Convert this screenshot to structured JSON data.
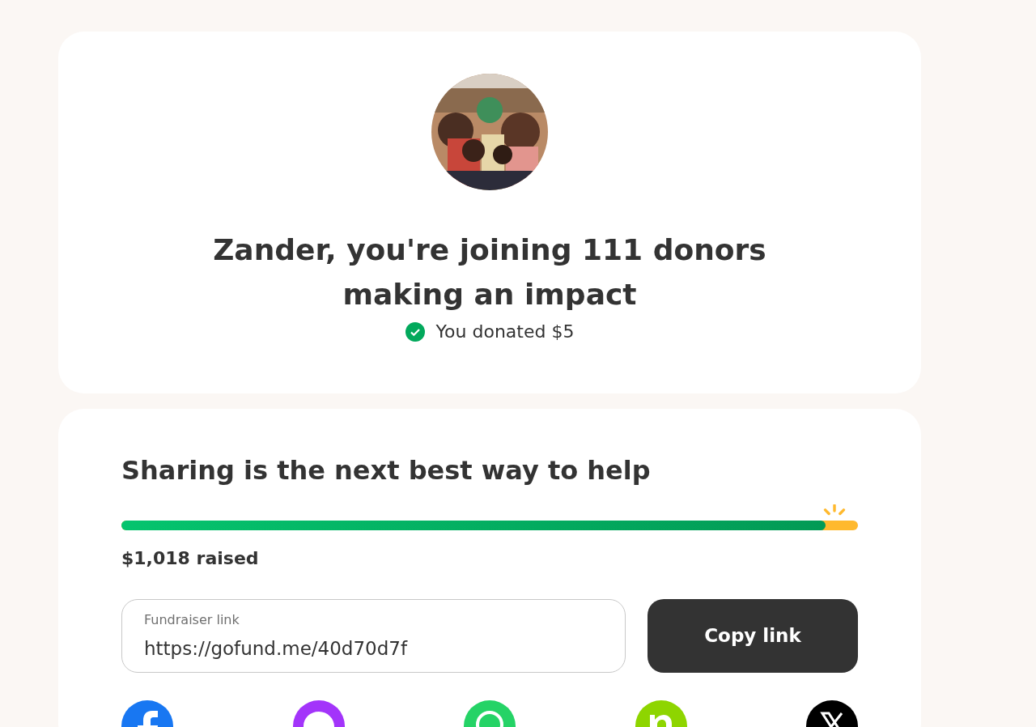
{
  "hero": {
    "kind": "picture",
    "title": "Zander, you're joining 111 donors making an impact",
    "confirmation": "You donated $5"
  },
  "share": {
    "heading": "Sharing is the next best way to help",
    "progress": {
      "level": 0.956
    },
    "raised": "$1,018 raised",
    "link_field": {
      "label": "Fundraiser link",
      "value": "https://gofund.me/40d70d7f"
    },
    "copy_button": "Copy link",
    "networks": [
      {
        "kind": "facebook",
        "color": "#1877f2"
      },
      {
        "kind": "messenger",
        "color": "#a334fa"
      },
      {
        "kind": "whatsapp",
        "color": "#25d366"
      },
      {
        "kind": "nextdoor",
        "color": "#8ed500"
      },
      {
        "kind": "x",
        "color": "#000000"
      }
    ]
  }
}
